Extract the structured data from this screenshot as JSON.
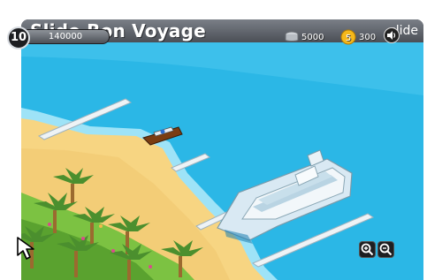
{
  "header": {
    "title": "Slide Bon Voyage",
    "brand": "slide"
  },
  "hud": {
    "level": "10",
    "xp": "140000",
    "coins": "5000",
    "gold": "300",
    "gold_icon_label": "5"
  },
  "icons": {
    "coins": "coin-stack-icon",
    "gold": "gold-coin-icon",
    "sound": "speaker-icon",
    "zoom_in": "zoom-in-icon",
    "zoom_out": "zoom-out-icon",
    "cursor": "arrow-cursor-icon"
  },
  "colors": {
    "sea": "#2bb7e6",
    "sand": "#f7d582",
    "dock": "#eef3f6",
    "ship": "#d9e9f3",
    "palm": "#4b8f2e",
    "chrome": "#2b2e33"
  }
}
